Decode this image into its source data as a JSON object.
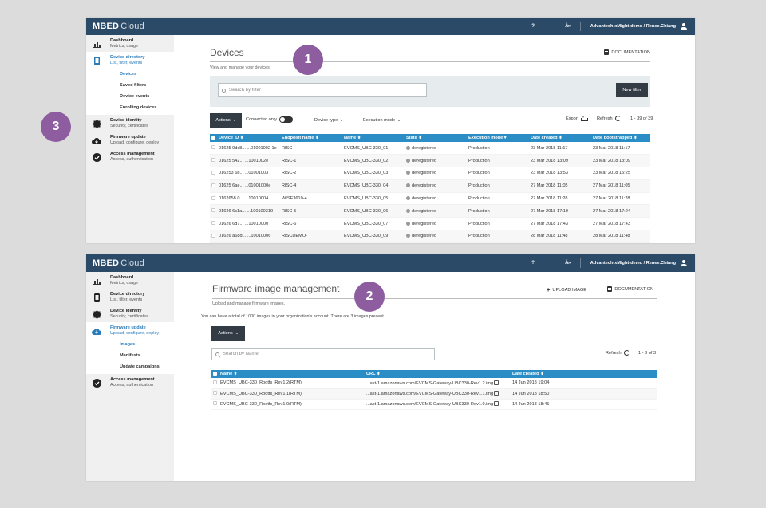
{
  "topbar": {
    "logo_main": "MBED",
    "logo_sub": "Cloud",
    "help": "?",
    "lang": "Å»",
    "user": "Advantech-xMight-demo / Renee.Chiang"
  },
  "sidebar1": {
    "dashboard": {
      "title": "Dashboard",
      "sub": "Metrics, usage"
    },
    "device_directory": {
      "title": "Device directory",
      "sub": "List, filter, events"
    },
    "subitems": [
      "Devices",
      "Saved filters",
      "Device events",
      "Enrolling devices"
    ],
    "device_identity": {
      "title": "Device identity",
      "sub": "Security, certificates"
    },
    "firmware_update": {
      "title": "Firmware update",
      "sub": "Upload, configure, deploy"
    },
    "access_management": {
      "title": "Access management",
      "sub": "Access, authentication"
    }
  },
  "sidebar2": {
    "dashboard": {
      "title": "Dashboard",
      "sub": "Metrics, usage"
    },
    "device_directory": {
      "title": "Device directory",
      "sub": "List, filter, events"
    },
    "device_identity": {
      "title": "Device identity",
      "sub": "Security, certificates"
    },
    "firmware_update": {
      "title": "Firmware update",
      "sub": "Upload, configure, deploy"
    },
    "subitems": [
      "Images",
      "Manifests",
      "Update campaigns"
    ],
    "access_management": {
      "title": "Access management",
      "sub": "Access, authentication"
    }
  },
  "devices": {
    "title": "Devices",
    "subtitle": "View and manage your devices.",
    "documentation": "DOCUMENTATION",
    "search_placeholder": "Search by filter",
    "new_filter": "New filter",
    "actions": "Actions",
    "connected_only": "Connected only",
    "device_type": "Device type",
    "execution_mode": "Execution mode",
    "export": "Export",
    "refresh": "Refresh",
    "pager": "1 - 39 of 39",
    "columns": [
      "Device ID ⬍",
      "Endpoint name ⬍",
      "Name ⬍",
      "State ⬍",
      "Execution mode ▾",
      "Date created ⬍",
      "Date bootstrapped ⬍"
    ],
    "rows": [
      [
        "01625 0dc8... ...01001002 1e",
        "RISC",
        "EVCMS_UBC-330_01",
        "deregistered",
        "Production",
        "23 Mar 2018 11:17",
        "23 Mar 2018 11:17"
      ],
      [
        "01625 542... ...1001002e",
        "RISC-1",
        "EVCMS_UBC-330_02",
        "deregistered",
        "Production",
        "23 Mar 2018 13:09",
        "23 Mar 2018 13:09"
      ],
      [
        "016253 6b... ...01001003",
        "RISC-2",
        "EVCMS_UBC-330_03",
        "deregistered",
        "Production",
        "23 Mar 2018 13:53",
        "23 Mar 2018 15:25"
      ],
      [
        "01625 6ae... ...01001000e",
        "RISC-4",
        "EVCMS_UBC-330_04",
        "deregistered",
        "Production",
        "27 Mar 2018 11:05",
        "27 Mar 2018 11:05"
      ],
      [
        "0162658 0... ...10010004",
        "WISE3610-4",
        "EVCMS_UBC-330_05",
        "deregistered",
        "Production",
        "27 Mar 2018 11:28",
        "27 Mar 2018 11:28"
      ],
      [
        "01626 6c1a... ...100100319",
        "RISC-5",
        "EVCMS_UBC-330_06",
        "deregistered",
        "Production",
        "27 Mar 2018 17:19",
        "27 Mar 2018 17:24"
      ],
      [
        "01626 6d7... ...10010000",
        "RISC-6",
        "EVCMS_UBC-330_07",
        "deregistered",
        "Production",
        "27 Mar 2018 17:43",
        "27 Mar 2018 17:43"
      ],
      [
        "01626 a68d... ...10010006",
        "RISCDEMO-",
        "EVCMS_UBC-330_09",
        "deregistered",
        "Production",
        "28 Mar 2018 11:48",
        "28 Mar 2018 11:48"
      ]
    ]
  },
  "firmware": {
    "title": "Firmware image management",
    "subtitle": "Upload and manage firmware images.",
    "upload": "UPLOAD IMAGE",
    "documentation": "DOCUMENTATION",
    "info": "You can have a total of 1000 images in your organization's account. There are 3 images present.",
    "actions": "Actions",
    "search_placeholder": "Search by Name",
    "refresh": "Refresh",
    "pager": "1 - 3 of 3",
    "columns": [
      "Name ⬍",
      "URL ⬍",
      "Date created ⬍"
    ],
    "rows": [
      [
        "EVCMS_UBC-330_Rootfs_Rev1.2(RTM)",
        "...ast-1.amazonaws.com/EVCMS-Gateway-UBC330-Rev1.2.img",
        "14 Jun 2018 19:04"
      ],
      [
        "EVCMS_UBC-330_Rootfs_Rev1.1(RTM)",
        "...ast-1.amazonaws.com/EVCMS-Gateway-UBC330-Rev1.1.img",
        "14 Jun 2018 18:50"
      ],
      [
        "EVCMS_UBC-330_Rootfs_Rev1.0(RTM)",
        "...ast-1.amazonaws.com/EVCMS-Gateway-UBC330-Rev1.0.img",
        "14 Jun 2018 18:45"
      ]
    ]
  },
  "badges": [
    "1",
    "2",
    "3"
  ],
  "colors": {
    "topbar": "#2b4a68",
    "accent": "#2a8dc5",
    "badge": "#8d5da0",
    "dark_button": "#333c44"
  }
}
